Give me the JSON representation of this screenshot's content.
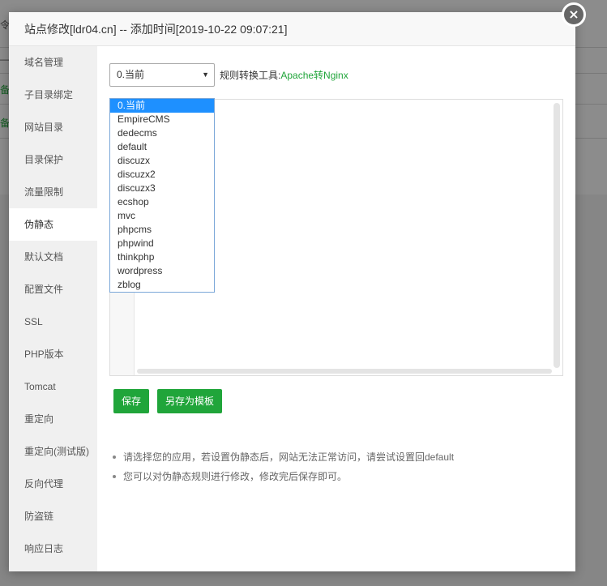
{
  "background": {
    "fragments": [
      "令",
      "—优",
      "备",
      "备"
    ]
  },
  "dialog": {
    "title": "站点修改[ldr04.cn] -- 添加时间[2019-10-22 09:07:21]",
    "close_label": "×"
  },
  "sidebar": {
    "items": [
      {
        "label": "域名管理"
      },
      {
        "label": "子目录绑定"
      },
      {
        "label": "网站目录"
      },
      {
        "label": "目录保护"
      },
      {
        "label": "流量限制"
      },
      {
        "label": "伪静态"
      },
      {
        "label": "默认文档"
      },
      {
        "label": "配置文件"
      },
      {
        "label": "SSL"
      },
      {
        "label": "PHP版本"
      },
      {
        "label": "Tomcat"
      },
      {
        "label": "重定向"
      },
      {
        "label": "重定向(测试版)"
      },
      {
        "label": "反向代理"
      },
      {
        "label": "防盗链"
      },
      {
        "label": "响应日志"
      }
    ],
    "active_index": 5
  },
  "rewrite": {
    "selected_value": "0.当前",
    "rule_tool_label": "规则转换工具:",
    "rule_tool_link": "Apache转Nginx",
    "options": [
      "0.当前",
      "EmpireCMS",
      "dedecms",
      "default",
      "discuzx",
      "discuzx2",
      "discuzx3",
      "ecshop",
      "mvc",
      "phpcms",
      "phpwind",
      "thinkphp",
      "wordpress",
      "zblog"
    ]
  },
  "buttons": {
    "save": "保存",
    "save_as_template": "另存为模板"
  },
  "notes": [
    "请选择您的应用，若设置伪静态后，网站无法正常访问，请尝试设置回default",
    "您可以对伪静态规则进行修改，修改完后保存即可。"
  ],
  "colors": {
    "accent": "#20a53a",
    "selected_option": "#1e90ff"
  }
}
